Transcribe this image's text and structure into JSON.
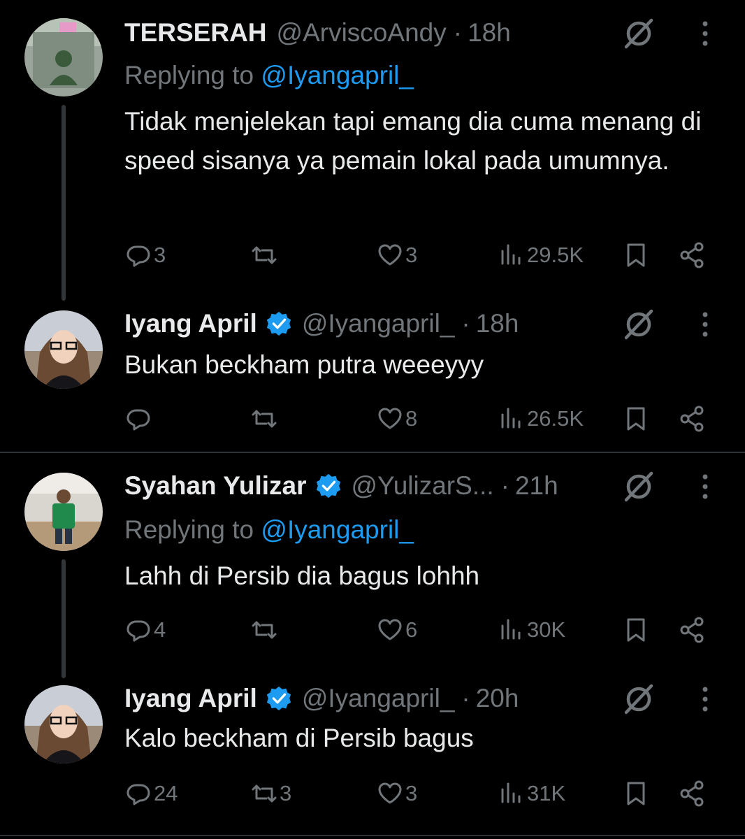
{
  "tweets": [
    {
      "name": "TERSERAH",
      "handle": "@ArviscoAndy",
      "separator": "·",
      "time": "18h",
      "replying_prefix": "Replying to ",
      "replying_to": "@Iyangapril_",
      "text": "Tidak menjelekan tapi emang dia cuma menang di speed sisanya ya pemain lokal pada umumnya.",
      "replies": "3",
      "retweets": "",
      "likes": "3",
      "views": "29.5K"
    },
    {
      "name": "Iyang April",
      "handle": "@Iyangapril_",
      "separator": "·",
      "time": "18h",
      "text": "Bukan beckham putra weeeyyy",
      "replies": "",
      "retweets": "",
      "likes": "8",
      "views": "26.5K"
    },
    {
      "name": "Syahan Yulizar",
      "handle": "@YulizarS...",
      "separator": "·",
      "time": "21h",
      "replying_prefix": "Replying to ",
      "replying_to": "@Iyangapril_",
      "text": "Lahh di Persib dia bagus lohhh",
      "replies": "4",
      "retweets": "",
      "likes": "6",
      "views": "30K"
    },
    {
      "name": "Iyang April",
      "handle": "@Iyangapril_",
      "separator": "·",
      "time": "20h",
      "text": "Kalo beckham di Persib bagus",
      "replies": "24",
      "retweets": "3",
      "likes": "3",
      "views": "31K"
    }
  ],
  "colors": {
    "background": "#000000",
    "text": "#e7e9ea",
    "muted": "#71767b",
    "link": "#1d9bf0",
    "verified": "#1d9bf0"
  }
}
